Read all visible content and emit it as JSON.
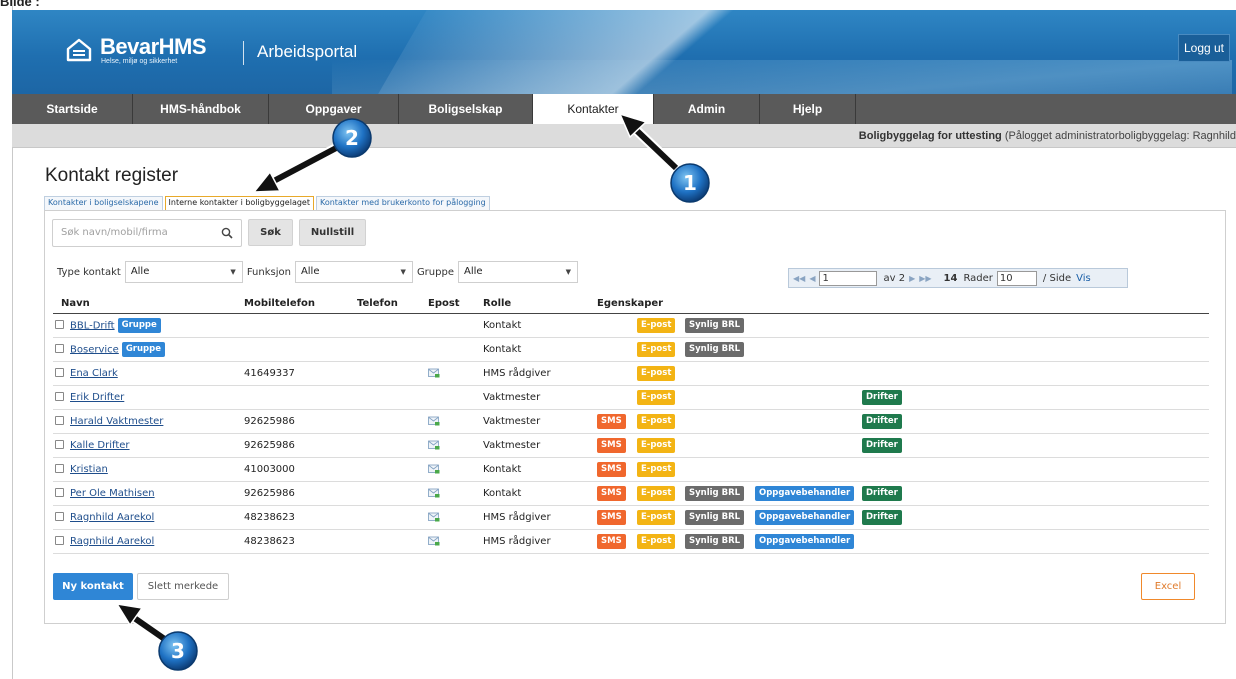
{
  "caption": "Bilde :",
  "header": {
    "logo_text": "BevarHMS",
    "logo_tagline": "Helse, miljø og sikkerhet",
    "portal_title": "Arbeidsportal",
    "logout_label": "Logg ut"
  },
  "nav": {
    "items": [
      {
        "label": "Startside"
      },
      {
        "label": "HMS-håndbok"
      },
      {
        "label": "Oppgaver"
      },
      {
        "label": "Boligselskap"
      },
      {
        "label": "Kontakter"
      },
      {
        "label": "Admin"
      },
      {
        "label": "Hjelp"
      }
    ],
    "active": "Kontakter"
  },
  "subbar": {
    "org_name": "Boligbyggelag for uttesting",
    "login_info": "(Pålogget administratorboligbyggelag: Ragnhild"
  },
  "page": {
    "title": "Kontakt register",
    "tabs": [
      {
        "label": "Kontakter i boligselskapene"
      },
      {
        "label": "Interne kontakter i boligbyggelaget"
      },
      {
        "label": "Kontakter med brukerkonto for pålogging"
      }
    ],
    "active_tab": "Interne kontakter i boligbyggelaget"
  },
  "search": {
    "placeholder": "Søk navn/mobil/firma",
    "search_label": "Søk",
    "reset_label": "Nullstill"
  },
  "filters": {
    "type_label": "Type kontakt",
    "type_value": "Alle",
    "function_label": "Funksjon",
    "function_value": "Alle",
    "group_label": "Gruppe",
    "group_value": "Alle"
  },
  "pager": {
    "page_value": "1",
    "of_label": "av 2",
    "count": "14",
    "rows_label": "Rader",
    "rows_value": "10",
    "per_page_label": "/ Side",
    "show_label": "Vis"
  },
  "table": {
    "headers": {
      "name": "Navn",
      "mobile": "Mobiltelefon",
      "phone": "Telefon",
      "email": "Epost",
      "role": "Rolle",
      "props": "Egenskaper"
    },
    "rows": [
      {
        "name": "BBL-Drift",
        "group": "Gruppe",
        "mobile": "",
        "mail": false,
        "role": "Kontakt",
        "sms": "",
        "epost": "E-post",
        "synlig": "Synlig BRL",
        "oppg": "",
        "drifter": ""
      },
      {
        "name": "Boservice",
        "group": "Gruppe",
        "mobile": "",
        "mail": false,
        "role": "Kontakt",
        "sms": "",
        "epost": "E-post",
        "synlig": "Synlig BRL",
        "oppg": "",
        "drifter": ""
      },
      {
        "name": "Ena Clark",
        "group": "",
        "mobile": "41649337",
        "mail": true,
        "role": "HMS rådgiver",
        "sms": "",
        "epost": "E-post",
        "synlig": "",
        "oppg": "",
        "drifter": ""
      },
      {
        "name": "Erik Drifter",
        "group": "",
        "mobile": "",
        "mail": false,
        "role": "Vaktmester",
        "sms": "",
        "epost": "E-post",
        "synlig": "",
        "oppg": "",
        "drifter": "Drifter"
      },
      {
        "name": "Harald Vaktmester",
        "group": "",
        "mobile": "92625986",
        "mail": true,
        "role": "Vaktmester",
        "sms": "SMS",
        "epost": "E-post",
        "synlig": "",
        "oppg": "",
        "drifter": "Drifter"
      },
      {
        "name": "Kalle Drifter",
        "group": "",
        "mobile": "92625986",
        "mail": true,
        "role": "Vaktmester",
        "sms": "SMS",
        "epost": "E-post",
        "synlig": "",
        "oppg": "",
        "drifter": "Drifter"
      },
      {
        "name": "Kristian",
        "group": "",
        "mobile": "41003000",
        "mail": true,
        "role": "Kontakt",
        "sms": "SMS",
        "epost": "E-post",
        "synlig": "",
        "oppg": "",
        "drifter": ""
      },
      {
        "name": "Per Ole Mathisen",
        "group": "",
        "mobile": "92625986",
        "mail": true,
        "role": "Kontakt",
        "sms": "SMS",
        "epost": "E-post",
        "synlig": "Synlig BRL",
        "oppg": "Oppgavebehandler",
        "drifter": "Drifter"
      },
      {
        "name": "Ragnhild Aarekol",
        "group": "",
        "mobile": "48238623",
        "mail": true,
        "role": "HMS rådgiver",
        "sms": "SMS",
        "epost": "E-post",
        "synlig": "Synlig BRL",
        "oppg": "Oppgavebehandler",
        "drifter": "Drifter"
      },
      {
        "name": "Ragnhild Aarekol",
        "group": "",
        "mobile": "48238623",
        "mail": true,
        "role": "HMS rådgiver",
        "sms": "SMS",
        "epost": "E-post",
        "synlig": "Synlig BRL",
        "oppg": "Oppgavebehandler",
        "drifter": ""
      }
    ]
  },
  "actions": {
    "new_contact": "Ny kontakt",
    "delete_marked": "Slett merkede",
    "excel": "Excel"
  },
  "callouts": [
    "1",
    "2",
    "3"
  ],
  "colors": {
    "header_blue": "#1f6fb0",
    "nav_grey": "#5a5a5a",
    "sms": "#f0672d",
    "epost": "#f3b414",
    "synlig": "#6b6b6b",
    "oppgave": "#2f86d6",
    "drifter": "#1f7a4d",
    "primary": "#2f86d6"
  }
}
